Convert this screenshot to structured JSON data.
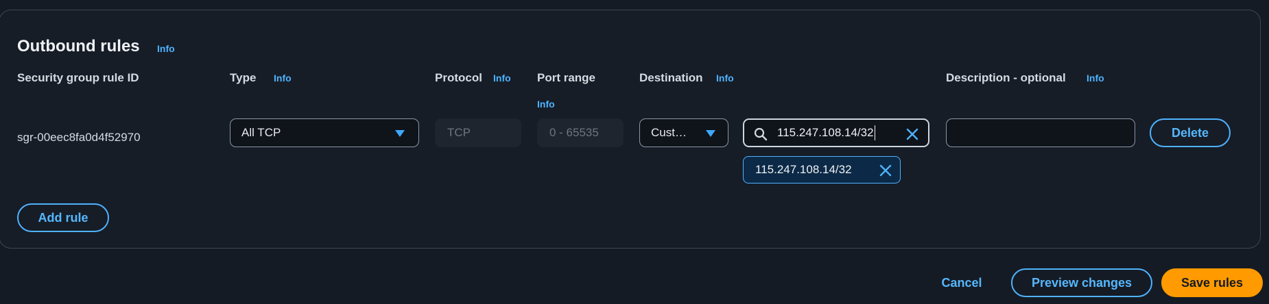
{
  "section": {
    "title": "Outbound rules",
    "info_label": "Info"
  },
  "columns": {
    "rule_id": "Security group rule ID",
    "type": "Type",
    "protocol": "Protocol",
    "port_range": "Port range",
    "destination": "Destination",
    "description": "Description - optional",
    "info_label": "Info"
  },
  "rule": {
    "id": "sgr-00eec8fa0d4f52970",
    "type_value": "All TCP",
    "protocol_value": "TCP",
    "port_range_value": "0 - 65535",
    "destination_type": "Cust…",
    "destination_search": "115.247.108.14/32",
    "destination_token": "115.247.108.14/32",
    "description_value": "",
    "delete_label": "Delete"
  },
  "actions": {
    "add_rule": "Add rule",
    "cancel": "Cancel",
    "preview": "Preview changes",
    "save": "Save rules"
  },
  "colors": {
    "accent": "#4fb3ff",
    "primary": "#ff9a00",
    "background": "#151b24"
  },
  "icons": {
    "search": "search-icon",
    "clear": "close-icon",
    "dropdown": "caret-down-icon"
  }
}
